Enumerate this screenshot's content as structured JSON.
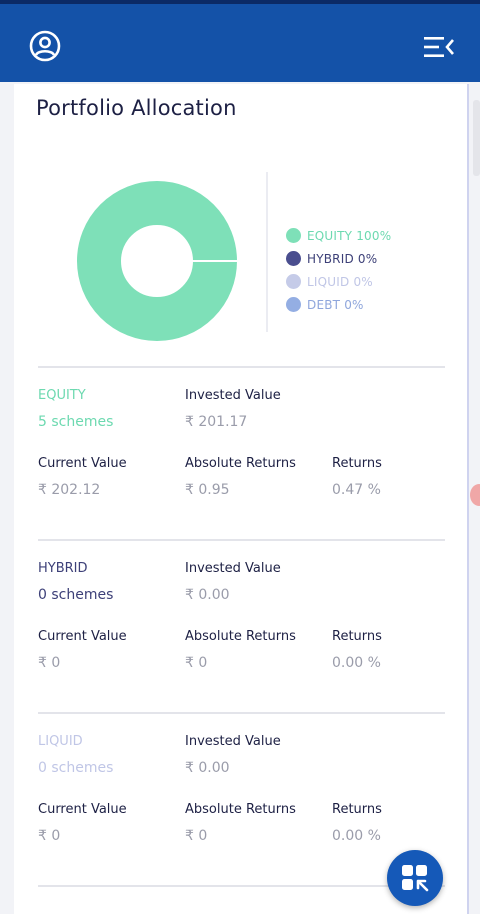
{
  "header": {
    "user_icon": "user-circle-icon",
    "menu_icon": "menu-collapse-icon"
  },
  "portfolio": {
    "title": "Portfolio Allocation",
    "legend": [
      {
        "label": "EQUITY 100%",
        "color": "#7ee0b8"
      },
      {
        "label": "HYBRID 0%",
        "color": "#4a4e8f"
      },
      {
        "label": "LIQUID 0%",
        "color": "#c5cbe8"
      },
      {
        "label": "DEBT 0%",
        "color": "#94aee3"
      }
    ],
    "allocation_percent": {
      "equity": 100,
      "hybrid": 0,
      "liquid": 0,
      "debt": 0
    }
  },
  "categories": [
    {
      "name": "EQUITY",
      "schemes": "5 schemes",
      "name_color": "#6dd9b0",
      "invested_label": "Invested Value",
      "invested_value": "₹ 201.17",
      "current_label": "Current Value",
      "current_value": "₹ 202.12",
      "abs_label": "Absolute Returns",
      "abs_value": "₹ 0.95",
      "returns_label": "Returns",
      "returns_value": "0.47 %"
    },
    {
      "name": "HYBRID",
      "schemes": "0 schemes",
      "name_color": "#3d4078",
      "invested_label": "Invested Value",
      "invested_value": "₹ 0.00",
      "current_label": "Current Value",
      "current_value": "₹ 0",
      "abs_label": "Absolute Returns",
      "abs_value": "₹ 0",
      "returns_label": "Returns",
      "returns_value": "0.00 %"
    },
    {
      "name": "LIQUID",
      "schemes": "0 schemes",
      "name_color": "#c0c6e6",
      "invested_label": "Invested Value",
      "invested_value": "₹ 0.00",
      "current_label": "Current Value",
      "current_value": "₹ 0",
      "abs_label": "Absolute Returns",
      "abs_value": "₹ 0",
      "returns_label": "Returns",
      "returns_value": "0.00 %"
    }
  ],
  "fab": {
    "icon": "apps-grid-icon"
  },
  "colors": {
    "header": "#1452a8",
    "accent": "#1559b8",
    "text": "#1d2044",
    "muted": "#9a9caa"
  }
}
